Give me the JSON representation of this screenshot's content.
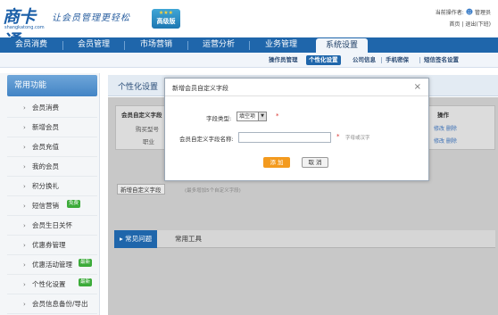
{
  "brand": {
    "logo_text": "商卡通",
    "logo_domain": "shangkatong.com",
    "slogan": "让会员管理更轻松",
    "edition_stars": "★★★",
    "edition_label": "高级版"
  },
  "topbar": {
    "operator_label": "当前操作者:",
    "operator_name": "管理员",
    "home_link": "首页",
    "logout_link": "退出(下班)",
    "divider": "|"
  },
  "main_nav": {
    "items": [
      "会员消费",
      "会员管理",
      "市场营销",
      "运营分析",
      "业务管理",
      "系统设置"
    ],
    "active_index": 5
  },
  "sub_nav": {
    "items": [
      "操作员管理",
      "个性化设置",
      "公司信息",
      "手机密保",
      "短信签名设置"
    ],
    "active_index": 1
  },
  "sidebar": {
    "title": "常用功能",
    "items": [
      {
        "label": "会员消费"
      },
      {
        "label": "新增会员"
      },
      {
        "label": "会员充值"
      },
      {
        "label": "我的会员"
      },
      {
        "label": "积分换礼"
      },
      {
        "label": "短信营销",
        "badge": "免费"
      },
      {
        "label": "会员生日关怀"
      },
      {
        "label": "优惠券管理"
      },
      {
        "label": "优惠活动管理",
        "badge": "最新"
      },
      {
        "label": "个性化设置",
        "badge": "最新"
      },
      {
        "label": "会员信息备份/导出"
      }
    ]
  },
  "content": {
    "title": "个性化设置",
    "table": {
      "header_left": "会员自定义字段",
      "header_right": "操作",
      "rows": [
        {
          "name": "购买型号",
          "ops": "修改 删除"
        },
        {
          "name": "职业",
          "ops": "修改 删除"
        }
      ]
    },
    "add_field_button": "新增自定义字段",
    "add_field_note": "(最多增加5个自定义字段)",
    "tabs": [
      "常见问题",
      "常用工具"
    ],
    "active_tab": 0
  },
  "modal": {
    "title": "新增会员自定义字段",
    "close_glyph": "×",
    "field_type_label": "字段类型:",
    "field_type_value": "填空项",
    "field_name_label": "会员自定义字段名称:",
    "field_name_value": "",
    "field_name_hint": "字母或汉字",
    "required_mark": "*",
    "add_button": "添 加",
    "cancel_button": "取 消"
  },
  "colors": {
    "primary_blue": "#1f66ab",
    "accent_orange": "#f39a1e",
    "badge_green": "#3cab3a",
    "required_red": "#d9302c"
  }
}
